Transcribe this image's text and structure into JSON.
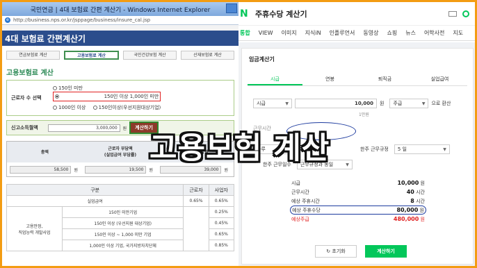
{
  "left": {
    "window_title": "국민연금 | 4대 보험료 간편 계산기 - Windows Internet Explorer",
    "address": "http://business.nps.or.kr/jsppage/business/insure_cal.jsp",
    "page_title": "4대 보험료 간편계산기",
    "tabs": [
      "연금보험료 계산",
      "고용보험료 계산",
      "국민건강보험 계산",
      "산재보험료 계산"
    ],
    "section_title": "고용보험료 계산",
    "worker_label": "근로자 수 선택",
    "options": [
      "150인 미만",
      "150인 이상 1,000인 미만",
      "1000인 이상",
      "150인이상(우선지원대상기업)"
    ],
    "income_label": "신고소득월액",
    "income_value": "3,000,000",
    "won": "원",
    "calc_button": "계산하기",
    "result_headers": [
      "총액",
      "근로자 부담액\n(실업급여 부담률)",
      "사업자 부담액"
    ],
    "results": [
      "58,500",
      "19,500",
      "39,000"
    ],
    "table_headers": [
      "구분",
      "",
      "근로자",
      "사업자"
    ],
    "table_rows": [
      {
        "group": "실업급여",
        "sub": "",
        "worker": "0.65%",
        "employer": "0.65%"
      },
      {
        "group": "고용안정,\n직업능력 개발사업",
        "sub": "150인 미만기업",
        "worker": "",
        "employer": "0.25%"
      },
      {
        "group": "",
        "sub": "150인 이상 (우선지원 대상기업)",
        "worker": "",
        "employer": "0.45%"
      },
      {
        "group": "",
        "sub": "150인 이상 ~ 1,000 미만 기업",
        "worker": "",
        "employer": "0.65%"
      },
      {
        "group": "",
        "sub": "1,000인 이상 기업, 국가지방자치단체",
        "worker": "",
        "employer": "0.85%"
      }
    ]
  },
  "right": {
    "logo": "N",
    "query": "주휴수당 계산기",
    "nav": [
      "통합",
      "VIEW",
      "이미지",
      "지식iN",
      "인플루언서",
      "동영상",
      "쇼핑",
      "뉴스",
      "어학사전",
      "지도"
    ],
    "card_title": "임금계산기",
    "tabs": [
      "시급",
      "연봉",
      "퇴직금",
      "실업급여"
    ],
    "wage_type": "시급",
    "wage_value": "10,000",
    "won": "원",
    "period": "주급",
    "convert": "으로 환산",
    "wage_hint": "1만원",
    "hours_label": "근무시간",
    "hours_type": "하루",
    "weekly_rule_label": "한주 근무규정",
    "weekly_rule": "5 일",
    "weekly_days_label": "한주 근무일수",
    "weekly_days": "근무규정과 동일",
    "summary": [
      {
        "label": "시급",
        "value": "10,000",
        "unit": "원"
      },
      {
        "label": "근무시간",
        "value": "40",
        "unit": "시간"
      },
      {
        "label": "예상 주휴시간",
        "value": "8",
        "unit": "시간"
      },
      {
        "label": "예상 주휴수당",
        "value": "80,000",
        "unit": "원"
      },
      {
        "label": "예상주급",
        "value": "480,000",
        "unit": "원"
      }
    ],
    "reset_button": "초기화",
    "calc_button": "계산하기"
  },
  "overlay_text": "고용보험 계산"
}
